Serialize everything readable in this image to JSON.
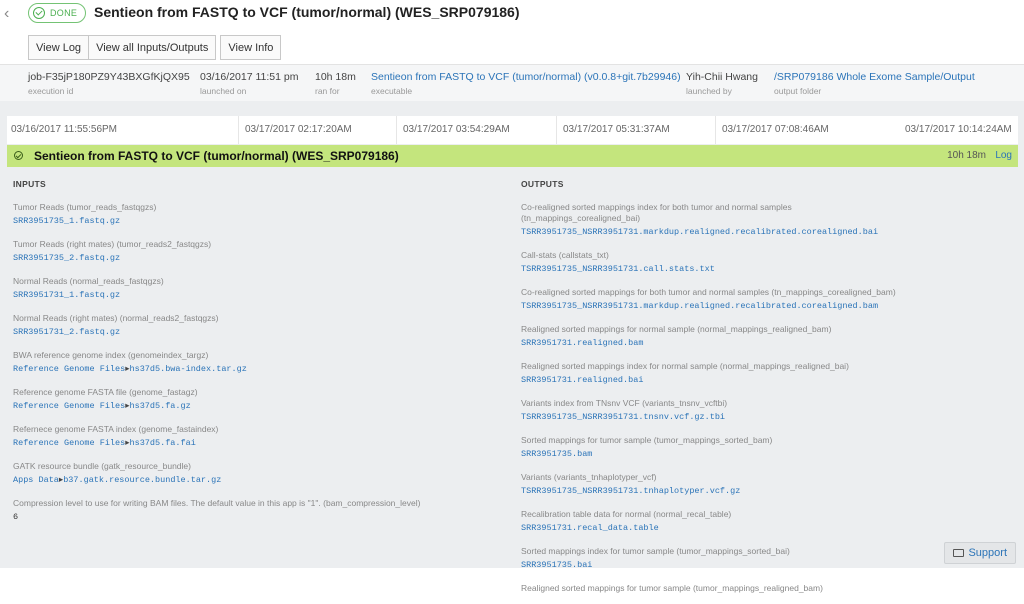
{
  "header": {
    "status": "DONE",
    "title": "Sentieon from FASTQ to VCF (tumor/normal) (WES_SRP079186)"
  },
  "buttons": {
    "view_log": "View Log",
    "view_io": "View all Inputs/Outputs",
    "view_info": "View Info"
  },
  "meta": [
    {
      "value": "job-F35jP180PZ9Y43BXGfKjQX95",
      "label": "execution id"
    },
    {
      "value": "03/16/2017 11:51 pm",
      "label": "launched on"
    },
    {
      "value": "10h 18m",
      "label": "ran for"
    },
    {
      "value": "Sentieon from FASTQ to VCF (tumor/normal) (v0.0.8+git.7b29946)",
      "label": "executable"
    },
    {
      "value": "Yih-Chii Hwang",
      "label": "launched by"
    },
    {
      "value": "/SRP079186 Whole Exome Sample/Output",
      "label": "output folder"
    }
  ],
  "timeline": {
    "ticks": [
      "03/16/2017 11:55:56PM",
      "03/17/2017 02:17:20AM",
      "03/17/2017 03:54:29AM",
      "03/17/2017 05:31:37AM",
      "03/17/2017 07:08:46AM",
      "03/17/2017 10:14:24AM"
    ],
    "stage_name": "Sentieon from FASTQ to VCF (tumor/normal) (WES_SRP079186)",
    "stage_duration": "10h 18m",
    "log_label": "Log"
  },
  "inputs": {
    "heading": "INPUTS",
    "fields": [
      {
        "label": "Tumor Reads (tumor_reads_fastqgzs)",
        "value": "SRR3951735_1.fastq.gz"
      },
      {
        "label": "Tumor Reads (right mates) (tumor_reads2_fastqgzs)",
        "value": "SRR3951735_2.fastq.gz"
      },
      {
        "label": "Normal Reads (normal_reads_fastqgzs)",
        "value": "SRR3951731_1.fastq.gz"
      },
      {
        "label": "Normal Reads (right mates) (normal_reads2_fastqgzs)",
        "value": "SRR3951731_2.fastq.gz"
      },
      {
        "label": "BWA reference genome index (genomeindex_targz)",
        "project": "Reference Genome Files",
        "value": "hs37d5.bwa-index.tar.gz"
      },
      {
        "label": "Reference genome FASTA file (genome_fastagz)",
        "project": "Reference Genome Files",
        "value": "hs37d5.fa.gz"
      },
      {
        "label": "Refernece genome FASTA index (genome_fastaindex)",
        "project": "Reference Genome Files",
        "value": "hs37d5.fa.fai"
      },
      {
        "label": "GATK resource bundle (gatk_resource_bundle)",
        "project": "Apps Data",
        "value": "b37.gatk.resource.bundle.tar.gz"
      },
      {
        "label": "Compression level to use for writing BAM files. The default value in this app is \"1\". (bam_compression_level)",
        "value": "6",
        "plain": true
      }
    ]
  },
  "outputs": {
    "heading": "OUTPUTS",
    "fields": [
      {
        "label": "Co-realigned sorted mappings index for both tumor and normal samples (tn_mappings_corealigned_bai)",
        "value": "TSRR3951735_NSRR3951731.markdup.realigned.recalibrated.corealigned.bai"
      },
      {
        "label": "Call-stats (callstats_txt)",
        "value": "TSRR3951735_NSRR3951731.call.stats.txt"
      },
      {
        "label": "Co-realigned sorted mappings for both tumor and normal samples (tn_mappings_corealigned_bam)",
        "value": "TSRR3951735_NSRR3951731.markdup.realigned.recalibrated.corealigned.bam"
      },
      {
        "label": "Realigned sorted mappings for normal sample (normal_mappings_realigned_bam)",
        "value": "SRR3951731.realigned.bam"
      },
      {
        "label": "Realigned sorted mappings index for normal sample (normal_mappings_realigned_bai)",
        "value": "SRR3951731.realigned.bai"
      },
      {
        "label": "Variants index from TNsnv VCF (variants_tnsnv_vcftbi)",
        "value": "TSRR3951735_NSRR3951731.tnsnv.vcf.gz.tbi"
      },
      {
        "label": "Sorted mappings for tumor sample (tumor_mappings_sorted_bam)",
        "value": "SRR3951735.bam"
      },
      {
        "label": "Variants (variants_tnhaplotyper_vcf)",
        "value": "TSRR3951735_NSRR3951731.tnhaplotyper.vcf.gz"
      },
      {
        "label": "Recalibration table data for normal (normal_recal_table)",
        "value": "SRR3951731.recal_data.table"
      },
      {
        "label": "Sorted mappings index for tumor sample (tumor_mappings_sorted_bai)",
        "value": "SRR3951735.bai"
      },
      {
        "label": "Realigned sorted mappings for tumor sample (tumor_mappings_realigned_bam)",
        "value": ""
      }
    ]
  },
  "support": {
    "label": "Support"
  },
  "colors": {
    "accent": "#2b74b8",
    "success": "#4caf50",
    "stage": "#c4e57d"
  }
}
